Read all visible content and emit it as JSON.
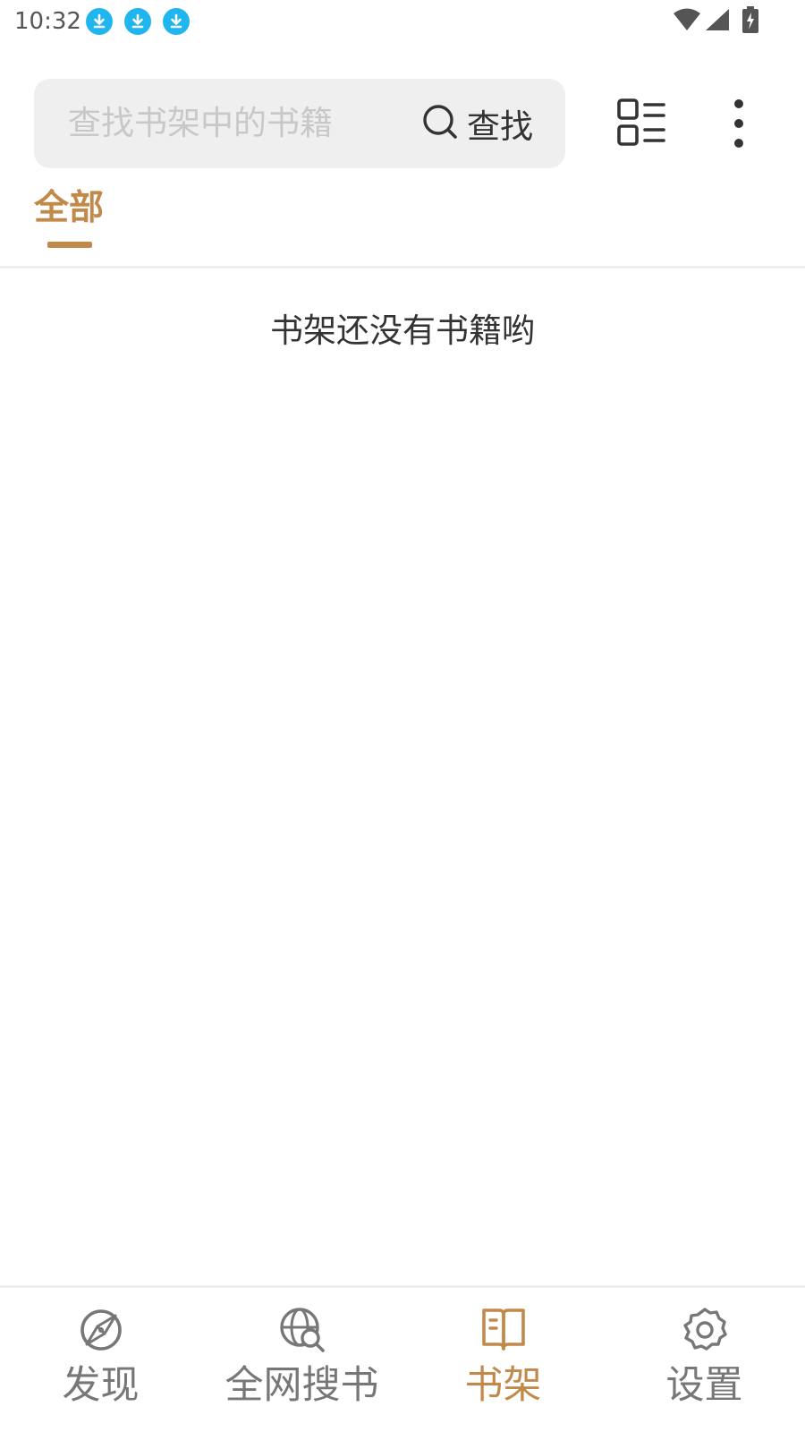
{
  "status_bar": {
    "time": "10:32",
    "notification_icons": [
      "download-icon",
      "download-icon",
      "download-icon"
    ],
    "system_icons": [
      "wifi-icon",
      "cellular-signal-icon",
      "battery-charging-icon"
    ],
    "notification_color": "#1fb6f0"
  },
  "toolbar": {
    "search_placeholder": "查找书架中的书籍",
    "search_button_label": "查找",
    "search_button_icon": "search-icon",
    "layout_icon": "list-layout-icon",
    "more_icon": "more-vertical-icon"
  },
  "groups": {
    "tabs": [
      {
        "label": "全部",
        "selected": true
      }
    ]
  },
  "bookshelf": {
    "empty_message": "书架还没有书籍哟"
  },
  "bottom_nav": {
    "items": [
      {
        "label": "发现",
        "icon": "compass-icon",
        "active": false
      },
      {
        "label": "全网搜书",
        "icon": "globe-search-icon",
        "active": false
      },
      {
        "label": "书架",
        "icon": "book-open-icon",
        "active": true
      },
      {
        "label": "设置",
        "icon": "settings-gear-icon",
        "active": false
      }
    ]
  },
  "colors": {
    "accent": "#c28a4a",
    "text_primary": "#333333",
    "text_secondary": "#777777",
    "placeholder": "#c8c8c8",
    "search_background": "#efefef"
  }
}
